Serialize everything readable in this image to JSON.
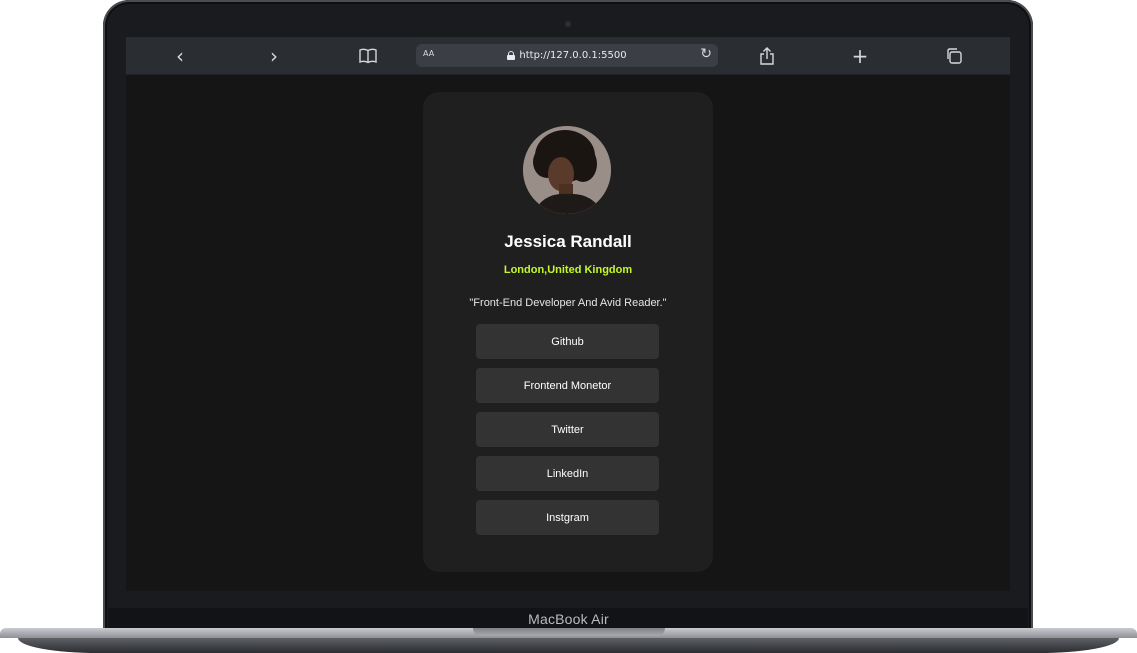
{
  "device": {
    "brand_label": "MacBook Air"
  },
  "browser": {
    "text_size_label": "AA",
    "url": "http://127.0.0.1:5500",
    "icons": [
      "back-icon",
      "forward-icon",
      "bookmarks-icon",
      "lock-icon",
      "reload-icon",
      "share-icon",
      "new-tab-icon",
      "tabs-icon"
    ]
  },
  "profile": {
    "name": "Jessica Randall",
    "location": "London,United Kingdom",
    "bio": "\"Front-End Developer And Avid Reader.\"",
    "links": [
      {
        "label": "Github"
      },
      {
        "label": "Frontend Monetor"
      },
      {
        "label": "Twitter"
      },
      {
        "label": "LinkedIn"
      },
      {
        "label": "Instgram"
      }
    ]
  },
  "colors": {
    "accent": "#c4f82a",
    "card_bg": "#1f1f1f",
    "button_bg": "#333333",
    "page_bg": "#151515"
  }
}
